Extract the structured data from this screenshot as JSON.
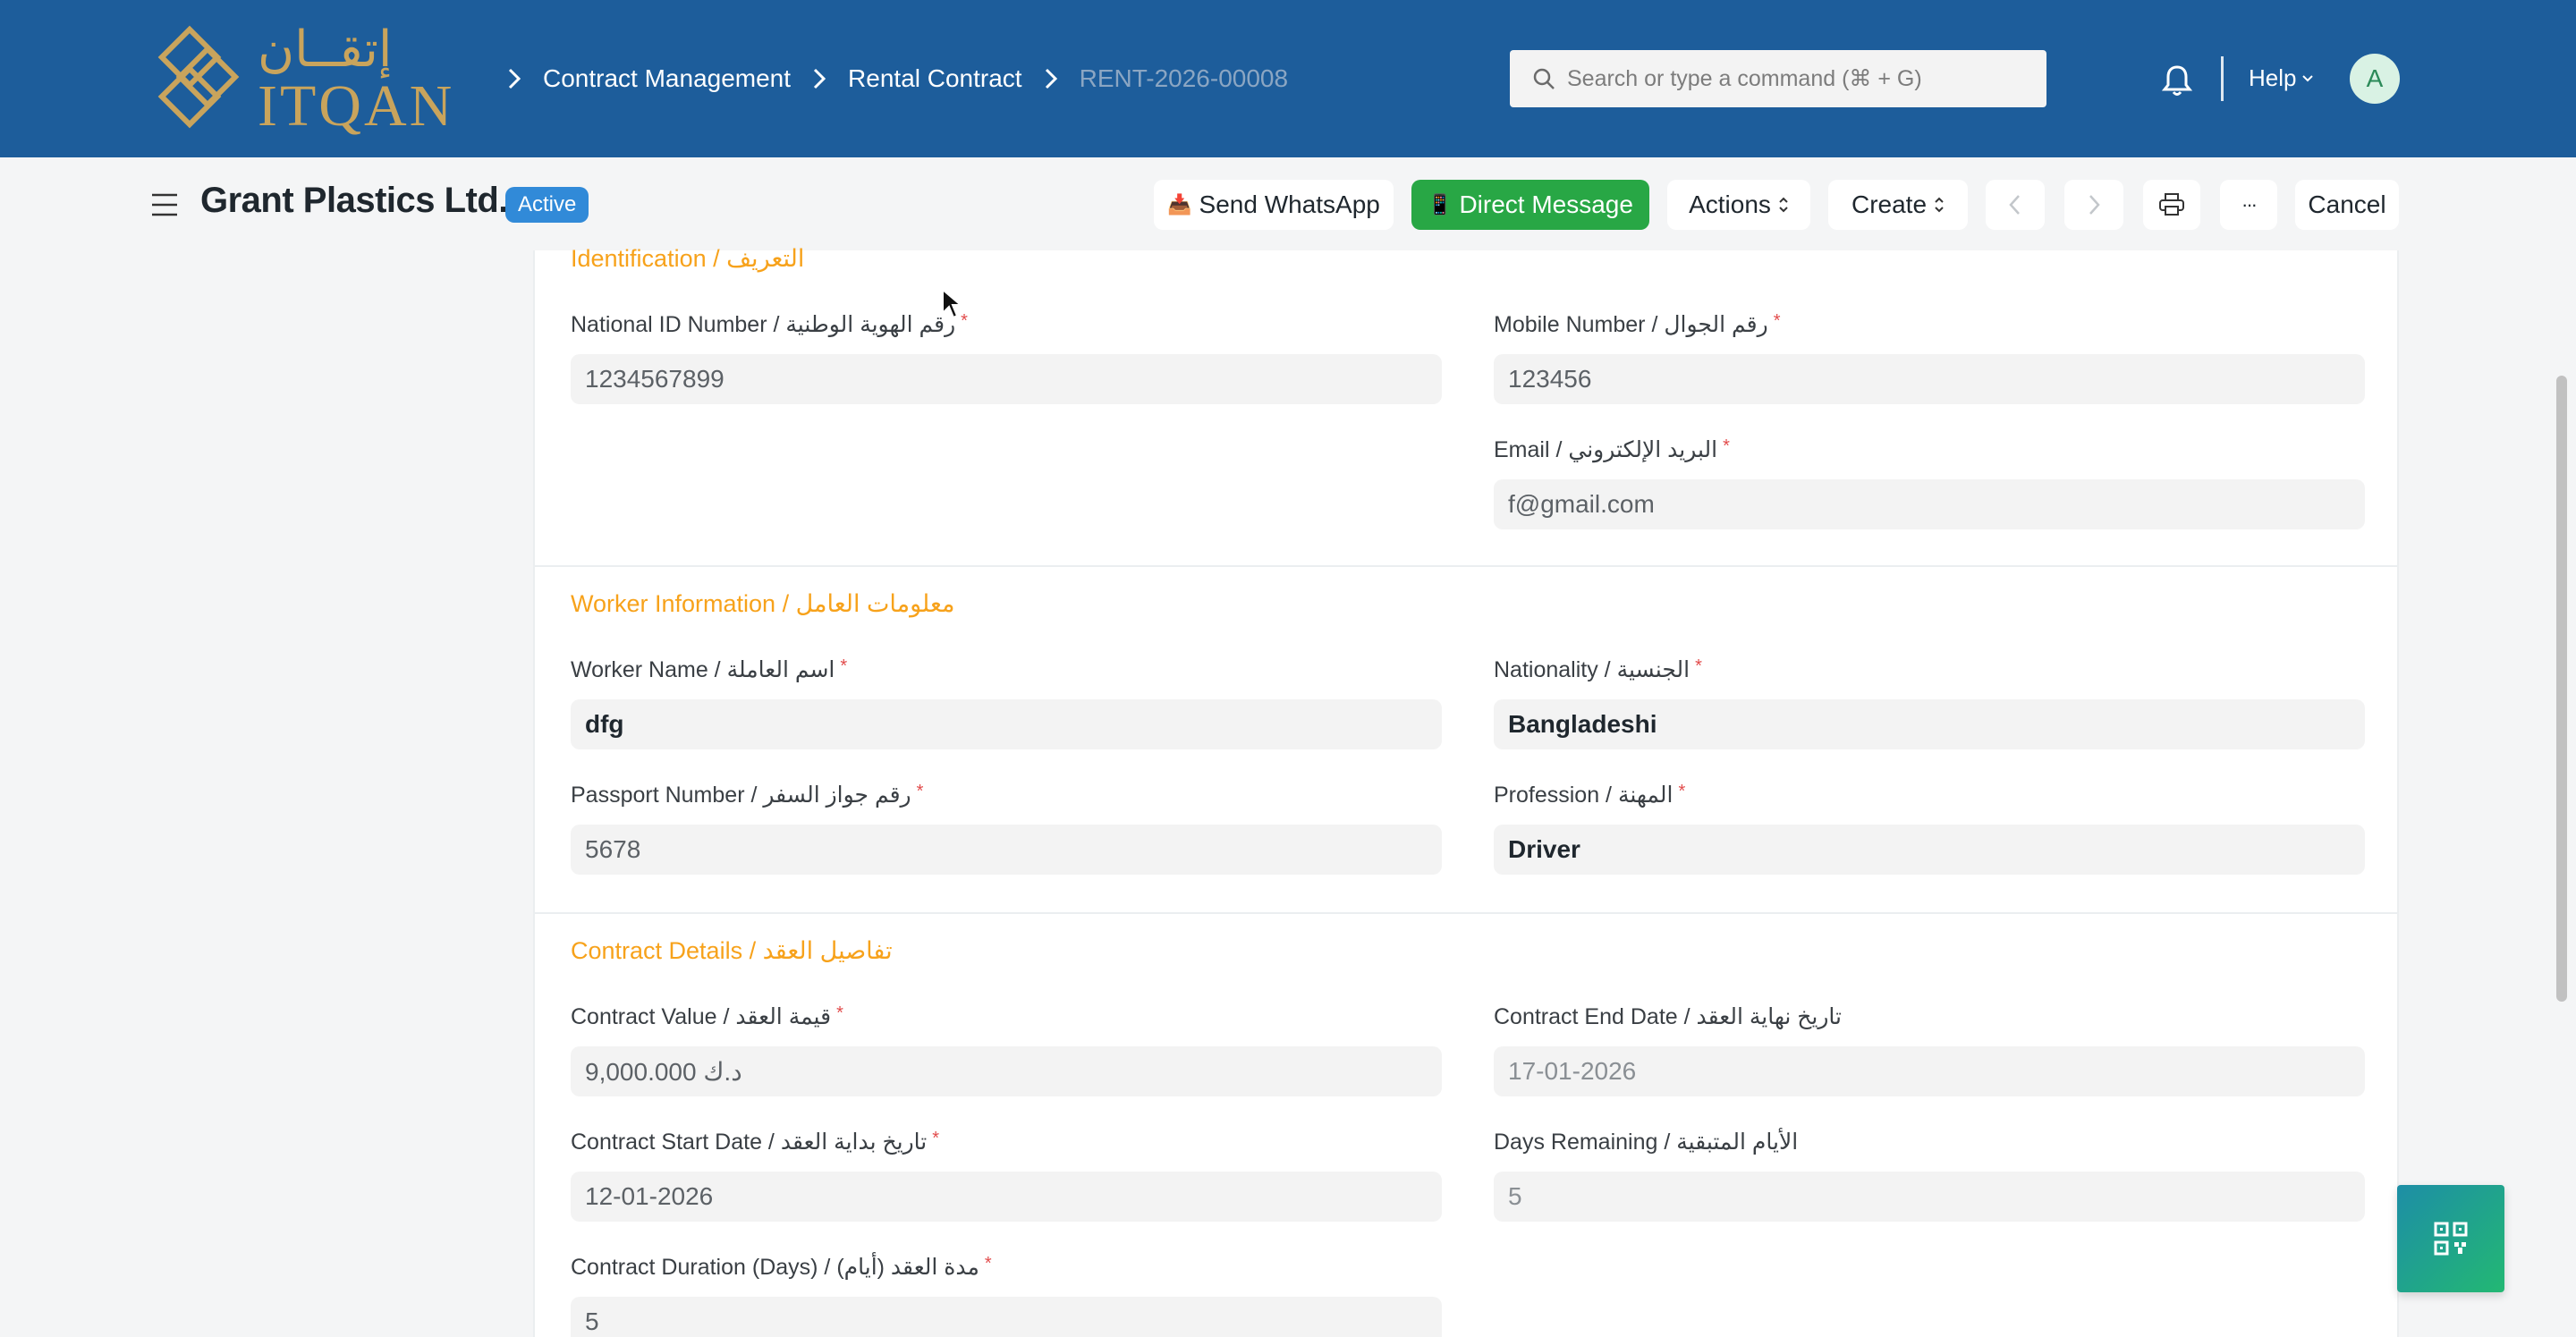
{
  "navbar": {
    "logo_text_arabic": "إتقــان",
    "logo_text_latin": "ITQAN",
    "breadcrumbs": [
      "Contract Management",
      "Rental Contract",
      "RENT-2026-00008"
    ],
    "search_placeholder": "Search or type a command (⌘ + G)",
    "help_label": "Help",
    "avatar_initial": "A"
  },
  "pagehead": {
    "title": "Grant Plastics Ltd.",
    "status": "Active",
    "buttons": {
      "whatsapp": "Send WhatsApp",
      "direct_message": "Direct Message",
      "actions": "Actions",
      "create": "Create",
      "more": "···",
      "cancel": "Cancel"
    }
  },
  "sections": {
    "identification": {
      "title": "Identification / التعريف",
      "national_id_label": "National ID Number / رقم الهوية الوطنية",
      "national_id_value": "1234567899",
      "mobile_label": "Mobile Number / رقم الجوال",
      "mobile_value": "123456",
      "email_label": "Email / البريد الإلكتروني",
      "email_value": "f@gmail.com"
    },
    "worker": {
      "title": "Worker Information / معلومات العامل",
      "name_label": "Worker Name / اسم العاملة",
      "name_value": "dfg",
      "nationality_label": "Nationality / الجنسية",
      "nationality_value": "Bangladeshi",
      "passport_label": "Passport Number / رقم جواز السفر",
      "passport_value": "5678",
      "profession_label": "Profession / المهنة",
      "profession_value": "Driver"
    },
    "contract": {
      "title": "Contract Details / تفاصيل العقد",
      "value_label": "Contract Value / قيمة العقد",
      "value_value": "9,000.000 د.ك",
      "end_date_label": "Contract End Date / تاريخ نهاية العقد",
      "end_date_value": "17-01-2026",
      "start_date_label": "Contract Start Date / تاريخ بداية العقد",
      "start_date_value": "12-01-2026",
      "days_remaining_label": "Days Remaining / الأيام المتبقية",
      "days_remaining_value": "5",
      "duration_label": "Contract Duration (Days) / مدة العقد (أيام)",
      "duration_value": "5"
    }
  },
  "required_marker": "*",
  "colors": {
    "navbar": "#1d5d9b",
    "section_title": "#f7a21b",
    "status_badge": "#318ad8",
    "direct_message": "#28a745",
    "logo_gold": "#c9a45c"
  }
}
